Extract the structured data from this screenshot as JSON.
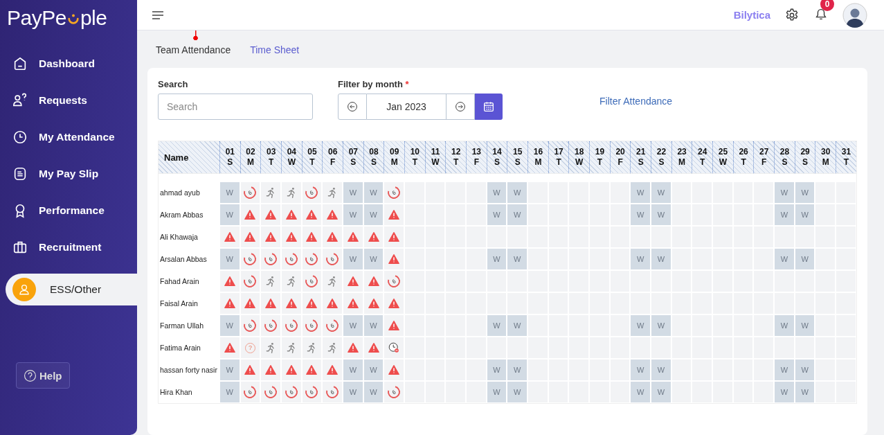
{
  "brand": {
    "text_before": "PayPe",
    "text_after": "ple"
  },
  "nav": [
    {
      "label": "Dashboard",
      "selected": false
    },
    {
      "label": "Requests",
      "selected": false
    },
    {
      "label": "My Attendance",
      "selected": false
    },
    {
      "label": "My Pay Slip",
      "selected": false
    },
    {
      "label": "Performance",
      "selected": false
    },
    {
      "label": "Recruitment",
      "selected": false
    },
    {
      "label": "ESS/Other",
      "selected": true
    }
  ],
  "help": "Help",
  "topbar": {
    "company": "Bilytica",
    "notifications": "0"
  },
  "tabs": [
    {
      "label": "Team Attendance",
      "selected": true
    },
    {
      "label": "Time Sheet",
      "selected": false
    }
  ],
  "filters": {
    "search_label": "Search",
    "search_placeholder": "Search",
    "month_label": "Filter by month",
    "required_mark": "*",
    "month": "Jan 2023",
    "filter_button": "Filter Attendance"
  },
  "table": {
    "name_header": "Name",
    "days": [
      {
        "d": "01",
        "w": "S"
      },
      {
        "d": "02",
        "w": "M"
      },
      {
        "d": "03",
        "w": "T"
      },
      {
        "d": "04",
        "w": "W"
      },
      {
        "d": "05",
        "w": "T"
      },
      {
        "d": "06",
        "w": "F"
      },
      {
        "d": "07",
        "w": "S"
      },
      {
        "d": "08",
        "w": "S"
      },
      {
        "d": "09",
        "w": "M"
      },
      {
        "d": "10",
        "w": "T"
      },
      {
        "d": "11",
        "w": "W"
      },
      {
        "d": "12",
        "w": "T"
      },
      {
        "d": "13",
        "w": "F"
      },
      {
        "d": "14",
        "w": "S"
      },
      {
        "d": "15",
        "w": "S"
      },
      {
        "d": "16",
        "w": "M"
      },
      {
        "d": "17",
        "w": "T"
      },
      {
        "d": "18",
        "w": "W"
      },
      {
        "d": "19",
        "w": "T"
      },
      {
        "d": "20",
        "w": "F"
      },
      {
        "d": "21",
        "w": "S"
      },
      {
        "d": "22",
        "w": "S"
      },
      {
        "d": "23",
        "w": "M"
      },
      {
        "d": "24",
        "w": "T"
      },
      {
        "d": "25",
        "w": "W"
      },
      {
        "d": "26",
        "w": "T"
      },
      {
        "d": "27",
        "w": "F"
      },
      {
        "d": "28",
        "w": "S"
      },
      {
        "d": "29",
        "w": "S"
      },
      {
        "d": "30",
        "w": "M"
      },
      {
        "d": "31",
        "w": "T"
      }
    ],
    "rows": [
      {
        "name": "ahmad ayub",
        "cells": [
          {
            "kind": "weekend",
            "text": "W"
          },
          {
            "kind": "leave",
            "text": "6"
          },
          {
            "kind": "present"
          },
          {
            "kind": "present"
          },
          {
            "kind": "leave",
            "text": "6"
          },
          {
            "kind": "present"
          },
          {
            "kind": "weekend",
            "text": "W"
          },
          {
            "kind": "weekend",
            "text": "W"
          },
          {
            "kind": "leave",
            "text": "6"
          },
          {
            "kind": "blank"
          },
          {
            "kind": "blank"
          },
          {
            "kind": "blank"
          },
          {
            "kind": "blank"
          },
          {
            "kind": "weekend",
            "text": "W"
          },
          {
            "kind": "weekend",
            "text": "W"
          },
          {
            "kind": "blank"
          },
          {
            "kind": "blank"
          },
          {
            "kind": "blank"
          },
          {
            "kind": "blank"
          },
          {
            "kind": "blank"
          },
          {
            "kind": "weekend",
            "text": "W"
          },
          {
            "kind": "weekend",
            "text": "W"
          },
          {
            "kind": "blank"
          },
          {
            "kind": "blank"
          },
          {
            "kind": "blank"
          },
          {
            "kind": "blank"
          },
          {
            "kind": "blank"
          },
          {
            "kind": "weekend",
            "text": "W"
          },
          {
            "kind": "weekend",
            "text": "W"
          },
          {
            "kind": "blank"
          },
          {
            "kind": "blank"
          }
        ]
      },
      {
        "name": "Akram Abbas",
        "cells": [
          {
            "kind": "weekend",
            "text": "W"
          },
          {
            "kind": "absent"
          },
          {
            "kind": "absent"
          },
          {
            "kind": "absent"
          },
          {
            "kind": "absent"
          },
          {
            "kind": "absent"
          },
          {
            "kind": "weekend",
            "text": "W"
          },
          {
            "kind": "weekend",
            "text": "W"
          },
          {
            "kind": "absent"
          },
          {
            "kind": "blank"
          },
          {
            "kind": "blank"
          },
          {
            "kind": "blank"
          },
          {
            "kind": "blank"
          },
          {
            "kind": "weekend",
            "text": "W"
          },
          {
            "kind": "weekend",
            "text": "W"
          },
          {
            "kind": "blank"
          },
          {
            "kind": "blank"
          },
          {
            "kind": "blank"
          },
          {
            "kind": "blank"
          },
          {
            "kind": "blank"
          },
          {
            "kind": "weekend",
            "text": "W"
          },
          {
            "kind": "weekend",
            "text": "W"
          },
          {
            "kind": "blank"
          },
          {
            "kind": "blank"
          },
          {
            "kind": "blank"
          },
          {
            "kind": "blank"
          },
          {
            "kind": "blank"
          },
          {
            "kind": "weekend",
            "text": "W"
          },
          {
            "kind": "weekend",
            "text": "W"
          },
          {
            "kind": "blank"
          },
          {
            "kind": "blank"
          }
        ]
      },
      {
        "name": "Ali Khawaja",
        "cells": [
          {
            "kind": "absent"
          },
          {
            "kind": "absent"
          },
          {
            "kind": "absent"
          },
          {
            "kind": "absent"
          },
          {
            "kind": "absent"
          },
          {
            "kind": "absent"
          },
          {
            "kind": "absent"
          },
          {
            "kind": "absent"
          },
          {
            "kind": "absent"
          },
          {
            "kind": "blank"
          },
          {
            "kind": "blank"
          },
          {
            "kind": "blank"
          },
          {
            "kind": "blank"
          },
          {
            "kind": "blank"
          },
          {
            "kind": "blank"
          },
          {
            "kind": "blank"
          },
          {
            "kind": "blank"
          },
          {
            "kind": "blank"
          },
          {
            "kind": "blank"
          },
          {
            "kind": "blank"
          },
          {
            "kind": "blank"
          },
          {
            "kind": "blank"
          },
          {
            "kind": "blank"
          },
          {
            "kind": "blank"
          },
          {
            "kind": "blank"
          },
          {
            "kind": "blank"
          },
          {
            "kind": "blank"
          },
          {
            "kind": "blank"
          },
          {
            "kind": "blank"
          },
          {
            "kind": "blank"
          },
          {
            "kind": "blank"
          }
        ]
      },
      {
        "name": "Arsalan Abbas",
        "cells": [
          {
            "kind": "weekend",
            "text": "W"
          },
          {
            "kind": "leave",
            "text": "6"
          },
          {
            "kind": "leave",
            "text": "6"
          },
          {
            "kind": "leave",
            "text": "6"
          },
          {
            "kind": "leave",
            "text": "6"
          },
          {
            "kind": "leave",
            "text": "6"
          },
          {
            "kind": "weekend",
            "text": "W"
          },
          {
            "kind": "weekend",
            "text": "W"
          },
          {
            "kind": "absent"
          },
          {
            "kind": "blank"
          },
          {
            "kind": "blank"
          },
          {
            "kind": "blank"
          },
          {
            "kind": "blank"
          },
          {
            "kind": "weekend",
            "text": "W"
          },
          {
            "kind": "weekend",
            "text": "W"
          },
          {
            "kind": "blank"
          },
          {
            "kind": "blank"
          },
          {
            "kind": "blank"
          },
          {
            "kind": "blank"
          },
          {
            "kind": "blank"
          },
          {
            "kind": "weekend",
            "text": "W"
          },
          {
            "kind": "weekend",
            "text": "W"
          },
          {
            "kind": "blank"
          },
          {
            "kind": "blank"
          },
          {
            "kind": "blank"
          },
          {
            "kind": "blank"
          },
          {
            "kind": "blank"
          },
          {
            "kind": "weekend",
            "text": "W"
          },
          {
            "kind": "weekend",
            "text": "W"
          },
          {
            "kind": "blank"
          },
          {
            "kind": "blank"
          }
        ]
      },
      {
        "name": "Fahad Arain",
        "cells": [
          {
            "kind": "absent"
          },
          {
            "kind": "leave",
            "text": "6"
          },
          {
            "kind": "present"
          },
          {
            "kind": "present"
          },
          {
            "kind": "leave",
            "text": "6"
          },
          {
            "kind": "present"
          },
          {
            "kind": "absent"
          },
          {
            "kind": "absent"
          },
          {
            "kind": "leave",
            "text": "6"
          },
          {
            "kind": "blank"
          },
          {
            "kind": "blank"
          },
          {
            "kind": "blank"
          },
          {
            "kind": "blank"
          },
          {
            "kind": "blank"
          },
          {
            "kind": "blank"
          },
          {
            "kind": "blank"
          },
          {
            "kind": "blank"
          },
          {
            "kind": "blank"
          },
          {
            "kind": "blank"
          },
          {
            "kind": "blank"
          },
          {
            "kind": "blank"
          },
          {
            "kind": "blank"
          },
          {
            "kind": "blank"
          },
          {
            "kind": "blank"
          },
          {
            "kind": "blank"
          },
          {
            "kind": "blank"
          },
          {
            "kind": "blank"
          },
          {
            "kind": "blank"
          },
          {
            "kind": "blank"
          },
          {
            "kind": "blank"
          },
          {
            "kind": "blank"
          }
        ]
      },
      {
        "name": "Faisal Arain",
        "cells": [
          {
            "kind": "absent"
          },
          {
            "kind": "absent"
          },
          {
            "kind": "absent"
          },
          {
            "kind": "absent"
          },
          {
            "kind": "absent"
          },
          {
            "kind": "absent"
          },
          {
            "kind": "absent"
          },
          {
            "kind": "absent"
          },
          {
            "kind": "absent"
          },
          {
            "kind": "blank"
          },
          {
            "kind": "blank"
          },
          {
            "kind": "blank"
          },
          {
            "kind": "blank"
          },
          {
            "kind": "blank"
          },
          {
            "kind": "blank"
          },
          {
            "kind": "blank"
          },
          {
            "kind": "blank"
          },
          {
            "kind": "blank"
          },
          {
            "kind": "blank"
          },
          {
            "kind": "blank"
          },
          {
            "kind": "blank"
          },
          {
            "kind": "blank"
          },
          {
            "kind": "blank"
          },
          {
            "kind": "blank"
          },
          {
            "kind": "blank"
          },
          {
            "kind": "blank"
          },
          {
            "kind": "blank"
          },
          {
            "kind": "blank"
          },
          {
            "kind": "blank"
          },
          {
            "kind": "blank"
          },
          {
            "kind": "blank"
          }
        ]
      },
      {
        "name": "Farman Ullah",
        "cells": [
          {
            "kind": "weekend",
            "text": "W"
          },
          {
            "kind": "leave",
            "text": "6"
          },
          {
            "kind": "leave",
            "text": "6"
          },
          {
            "kind": "leave",
            "text": "6"
          },
          {
            "kind": "leave",
            "text": "6"
          },
          {
            "kind": "leave",
            "text": "6"
          },
          {
            "kind": "weekend",
            "text": "W"
          },
          {
            "kind": "weekend",
            "text": "W"
          },
          {
            "kind": "absent"
          },
          {
            "kind": "blank"
          },
          {
            "kind": "blank"
          },
          {
            "kind": "blank"
          },
          {
            "kind": "blank"
          },
          {
            "kind": "weekend",
            "text": "W"
          },
          {
            "kind": "weekend",
            "text": "W"
          },
          {
            "kind": "blank"
          },
          {
            "kind": "blank"
          },
          {
            "kind": "blank"
          },
          {
            "kind": "blank"
          },
          {
            "kind": "blank"
          },
          {
            "kind": "weekend",
            "text": "W"
          },
          {
            "kind": "weekend",
            "text": "W"
          },
          {
            "kind": "blank"
          },
          {
            "kind": "blank"
          },
          {
            "kind": "blank"
          },
          {
            "kind": "blank"
          },
          {
            "kind": "blank"
          },
          {
            "kind": "weekend",
            "text": "W"
          },
          {
            "kind": "weekend",
            "text": "W"
          },
          {
            "kind": "blank"
          },
          {
            "kind": "blank"
          }
        ]
      },
      {
        "name": "Fatima Arain",
        "cells": [
          {
            "kind": "absent"
          },
          {
            "kind": "unknown",
            "text": "?"
          },
          {
            "kind": "present"
          },
          {
            "kind": "present"
          },
          {
            "kind": "present"
          },
          {
            "kind": "present"
          },
          {
            "kind": "absent"
          },
          {
            "kind": "absent"
          },
          {
            "kind": "late"
          },
          {
            "kind": "blank"
          },
          {
            "kind": "blank"
          },
          {
            "kind": "blank"
          },
          {
            "kind": "blank"
          },
          {
            "kind": "blank"
          },
          {
            "kind": "blank"
          },
          {
            "kind": "blank"
          },
          {
            "kind": "blank"
          },
          {
            "kind": "blank"
          },
          {
            "kind": "blank"
          },
          {
            "kind": "blank"
          },
          {
            "kind": "blank"
          },
          {
            "kind": "blank"
          },
          {
            "kind": "blank"
          },
          {
            "kind": "blank"
          },
          {
            "kind": "blank"
          },
          {
            "kind": "blank"
          },
          {
            "kind": "blank"
          },
          {
            "kind": "blank"
          },
          {
            "kind": "blank"
          },
          {
            "kind": "blank"
          },
          {
            "kind": "blank"
          }
        ]
      },
      {
        "name": "hassan forty nasir",
        "cells": [
          {
            "kind": "weekend",
            "text": "W"
          },
          {
            "kind": "absent"
          },
          {
            "kind": "absent"
          },
          {
            "kind": "absent"
          },
          {
            "kind": "absent"
          },
          {
            "kind": "absent"
          },
          {
            "kind": "weekend",
            "text": "W"
          },
          {
            "kind": "weekend",
            "text": "W"
          },
          {
            "kind": "absent"
          },
          {
            "kind": "blank"
          },
          {
            "kind": "blank"
          },
          {
            "kind": "blank"
          },
          {
            "kind": "blank"
          },
          {
            "kind": "weekend",
            "text": "W"
          },
          {
            "kind": "weekend",
            "text": "W"
          },
          {
            "kind": "blank"
          },
          {
            "kind": "blank"
          },
          {
            "kind": "blank"
          },
          {
            "kind": "blank"
          },
          {
            "kind": "blank"
          },
          {
            "kind": "weekend",
            "text": "W"
          },
          {
            "kind": "weekend",
            "text": "W"
          },
          {
            "kind": "blank"
          },
          {
            "kind": "blank"
          },
          {
            "kind": "blank"
          },
          {
            "kind": "blank"
          },
          {
            "kind": "blank"
          },
          {
            "kind": "weekend",
            "text": "W"
          },
          {
            "kind": "weekend",
            "text": "W"
          },
          {
            "kind": "blank"
          },
          {
            "kind": "blank"
          }
        ]
      },
      {
        "name": "Hira Khan",
        "cells": [
          {
            "kind": "weekend",
            "text": "W"
          },
          {
            "kind": "leave",
            "text": "6"
          },
          {
            "kind": "leave",
            "text": "6"
          },
          {
            "kind": "leave",
            "text": "6"
          },
          {
            "kind": "leave",
            "text": "6"
          },
          {
            "kind": "leave",
            "text": "6"
          },
          {
            "kind": "weekend",
            "text": "W"
          },
          {
            "kind": "weekend",
            "text": "W"
          },
          {
            "kind": "leave",
            "text": "6"
          },
          {
            "kind": "blank"
          },
          {
            "kind": "blank"
          },
          {
            "kind": "blank"
          },
          {
            "kind": "blank"
          },
          {
            "kind": "weekend",
            "text": "W"
          },
          {
            "kind": "weekend",
            "text": "W"
          },
          {
            "kind": "blank"
          },
          {
            "kind": "blank"
          },
          {
            "kind": "blank"
          },
          {
            "kind": "blank"
          },
          {
            "kind": "blank"
          },
          {
            "kind": "weekend",
            "text": "W"
          },
          {
            "kind": "weekend",
            "text": "W"
          },
          {
            "kind": "blank"
          },
          {
            "kind": "blank"
          },
          {
            "kind": "blank"
          },
          {
            "kind": "blank"
          },
          {
            "kind": "blank"
          },
          {
            "kind": "weekend",
            "text": "W"
          },
          {
            "kind": "weekend",
            "text": "W"
          },
          {
            "kind": "blank"
          },
          {
            "kind": "blank"
          }
        ]
      }
    ]
  }
}
